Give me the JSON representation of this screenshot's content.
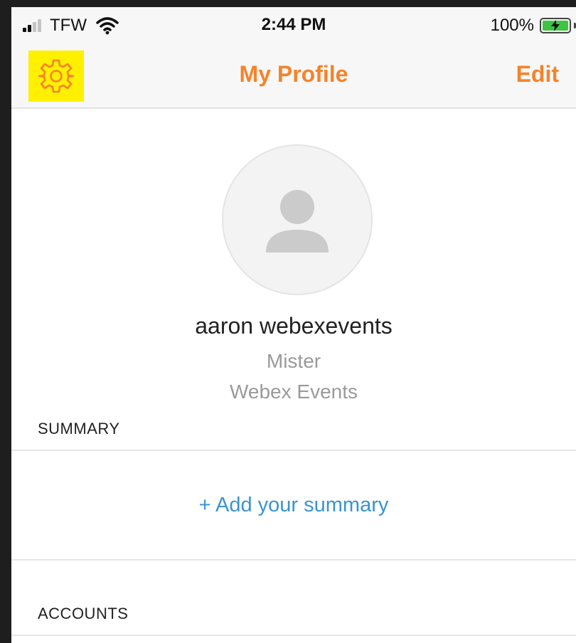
{
  "status_bar": {
    "carrier": "TFW",
    "time": "2:44 PM",
    "battery_percent": "100%",
    "signal_bars_active": 2,
    "signal_bars_total": 4,
    "icons": [
      "signal-icon",
      "wifi-icon",
      "battery-charging-icon"
    ]
  },
  "nav_bar": {
    "title": "My Profile",
    "edit_label": "Edit",
    "settings_icon": "gear-icon",
    "highlight_color": "#fff000"
  },
  "profile": {
    "avatar_icon": "person-placeholder-icon",
    "name": "aaron webexevents",
    "title": "Mister",
    "company": "Webex Events"
  },
  "summary": {
    "header": "SUMMARY",
    "add_link": "+ Add your summary"
  },
  "accounts": {
    "header": "ACCOUNTS"
  },
  "colors": {
    "accent": "#f5832a",
    "link": "#3a94d0",
    "secondary_text": "#9a9a9a",
    "battery": "#3ec443"
  }
}
